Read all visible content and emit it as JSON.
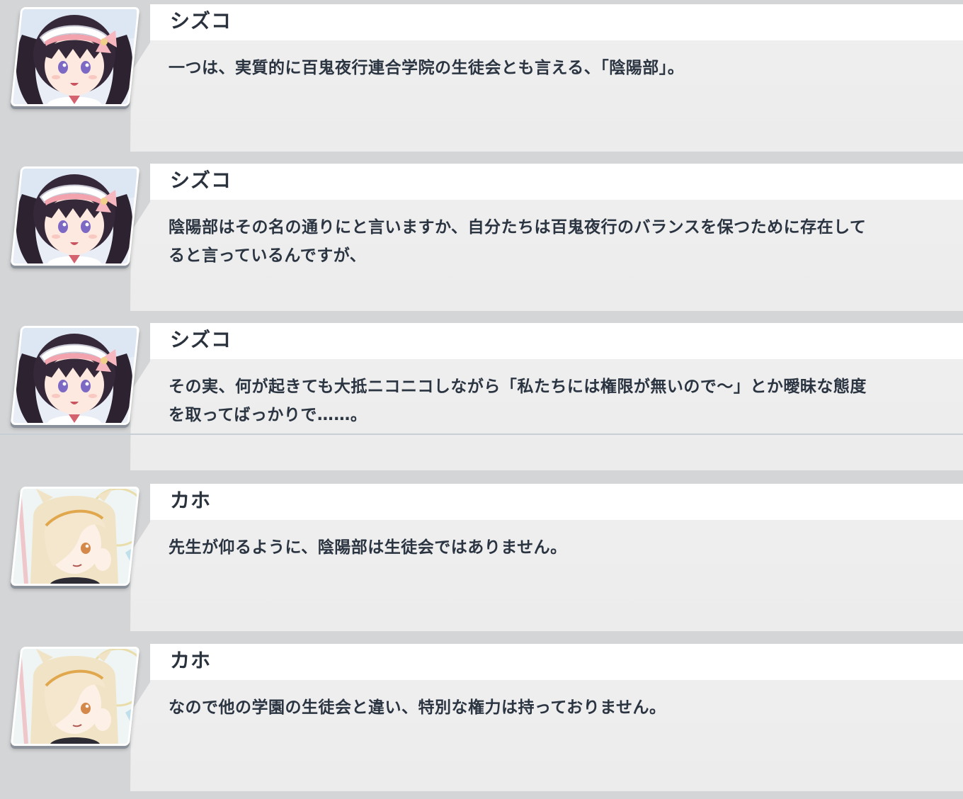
{
  "log": {
    "entries": [
      {
        "speaker": "シズコ",
        "avatar": "shizuko-portrait",
        "lines": [
          "一つは、実質的に百鬼夜行連合学院の生徒会とも言える、「陰陽部」。"
        ]
      },
      {
        "speaker": "シズコ",
        "avatar": "shizuko-portrait",
        "lines": [
          "陰陽部はその名の通りにと言いますか、自分たちは百鬼夜行のバランスを保つために存在して",
          "ると言っているんですが、"
        ]
      },
      {
        "speaker": "シズコ",
        "avatar": "shizuko-portrait",
        "lines": [
          "その実、何が起きても大抵ニコニコしながら「私たちには権限が無いので～」とか曖昧な態度",
          "を取ってばっかりで……。"
        ]
      },
      {
        "speaker": "カホ",
        "avatar": "kaho-portrait",
        "lines": [
          "先生が仰るように、陰陽部は生徒会ではありません。"
        ]
      },
      {
        "speaker": "カホ",
        "avatar": "kaho-portrait",
        "lines": [
          "なので他の学園の生徒会と違い、特別な権力は持っておりません。"
        ]
      }
    ]
  },
  "colors": {
    "page_background": "#d4d5d7",
    "bubble": "#eeeeee",
    "name_strip": "#ffffff",
    "text": "#2b3441"
  }
}
